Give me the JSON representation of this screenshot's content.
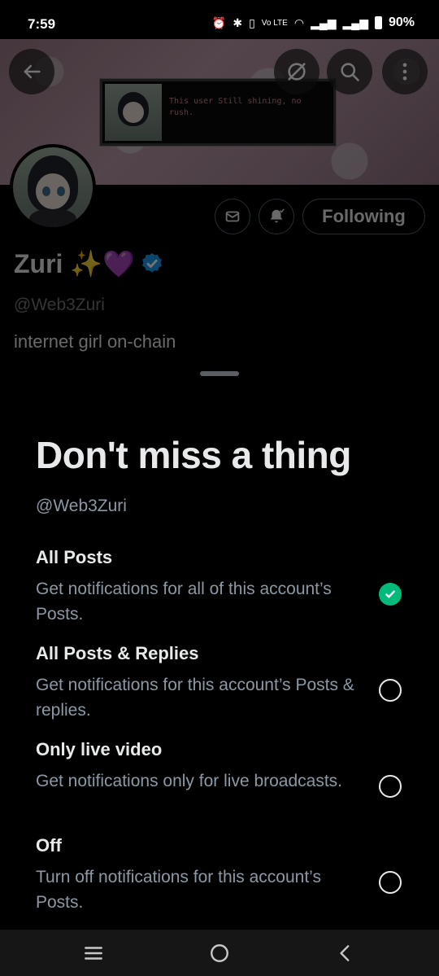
{
  "status_bar": {
    "time": "7:59",
    "battery": "90%",
    "icons": [
      "alarm-icon",
      "bluetooth-icon",
      "vibrate-icon",
      "volte-icon",
      "wifi-icon",
      "signal-icon",
      "signal-icon",
      "battery-icon"
    ]
  },
  "banner": {
    "message": "This user Still shining, no rush."
  },
  "header_buttons": {
    "back": "arrow-left-icon",
    "grok": "slash-circle-icon",
    "search": "search-icon",
    "more": "more-vertical-icon"
  },
  "profile": {
    "name": "Zuri ✨💜",
    "handle": "@Web3Zuri",
    "bio": "internet girl on-chain",
    "following_label": "Following",
    "verified_color": "#1d9bf0"
  },
  "sheet": {
    "title": "Don't miss a thing",
    "handle": "@Web3Zuri",
    "options": [
      {
        "title": "All Posts",
        "desc": "Get notifications for all of this account’s Posts.",
        "selected": true
      },
      {
        "title": "All Posts & Replies",
        "desc": "Get notifications for this account’s Posts & replies.",
        "selected": false
      },
      {
        "title": "Only live video",
        "desc": "Get notifications only for live broadcasts.",
        "selected": false
      },
      {
        "title": "Off",
        "desc": "Turn off notifications for this account’s Posts.",
        "selected": false
      }
    ],
    "accent": "#00ba7c"
  },
  "nav": {
    "recents": "recents-icon",
    "home": "home-icon",
    "back": "back-icon"
  }
}
